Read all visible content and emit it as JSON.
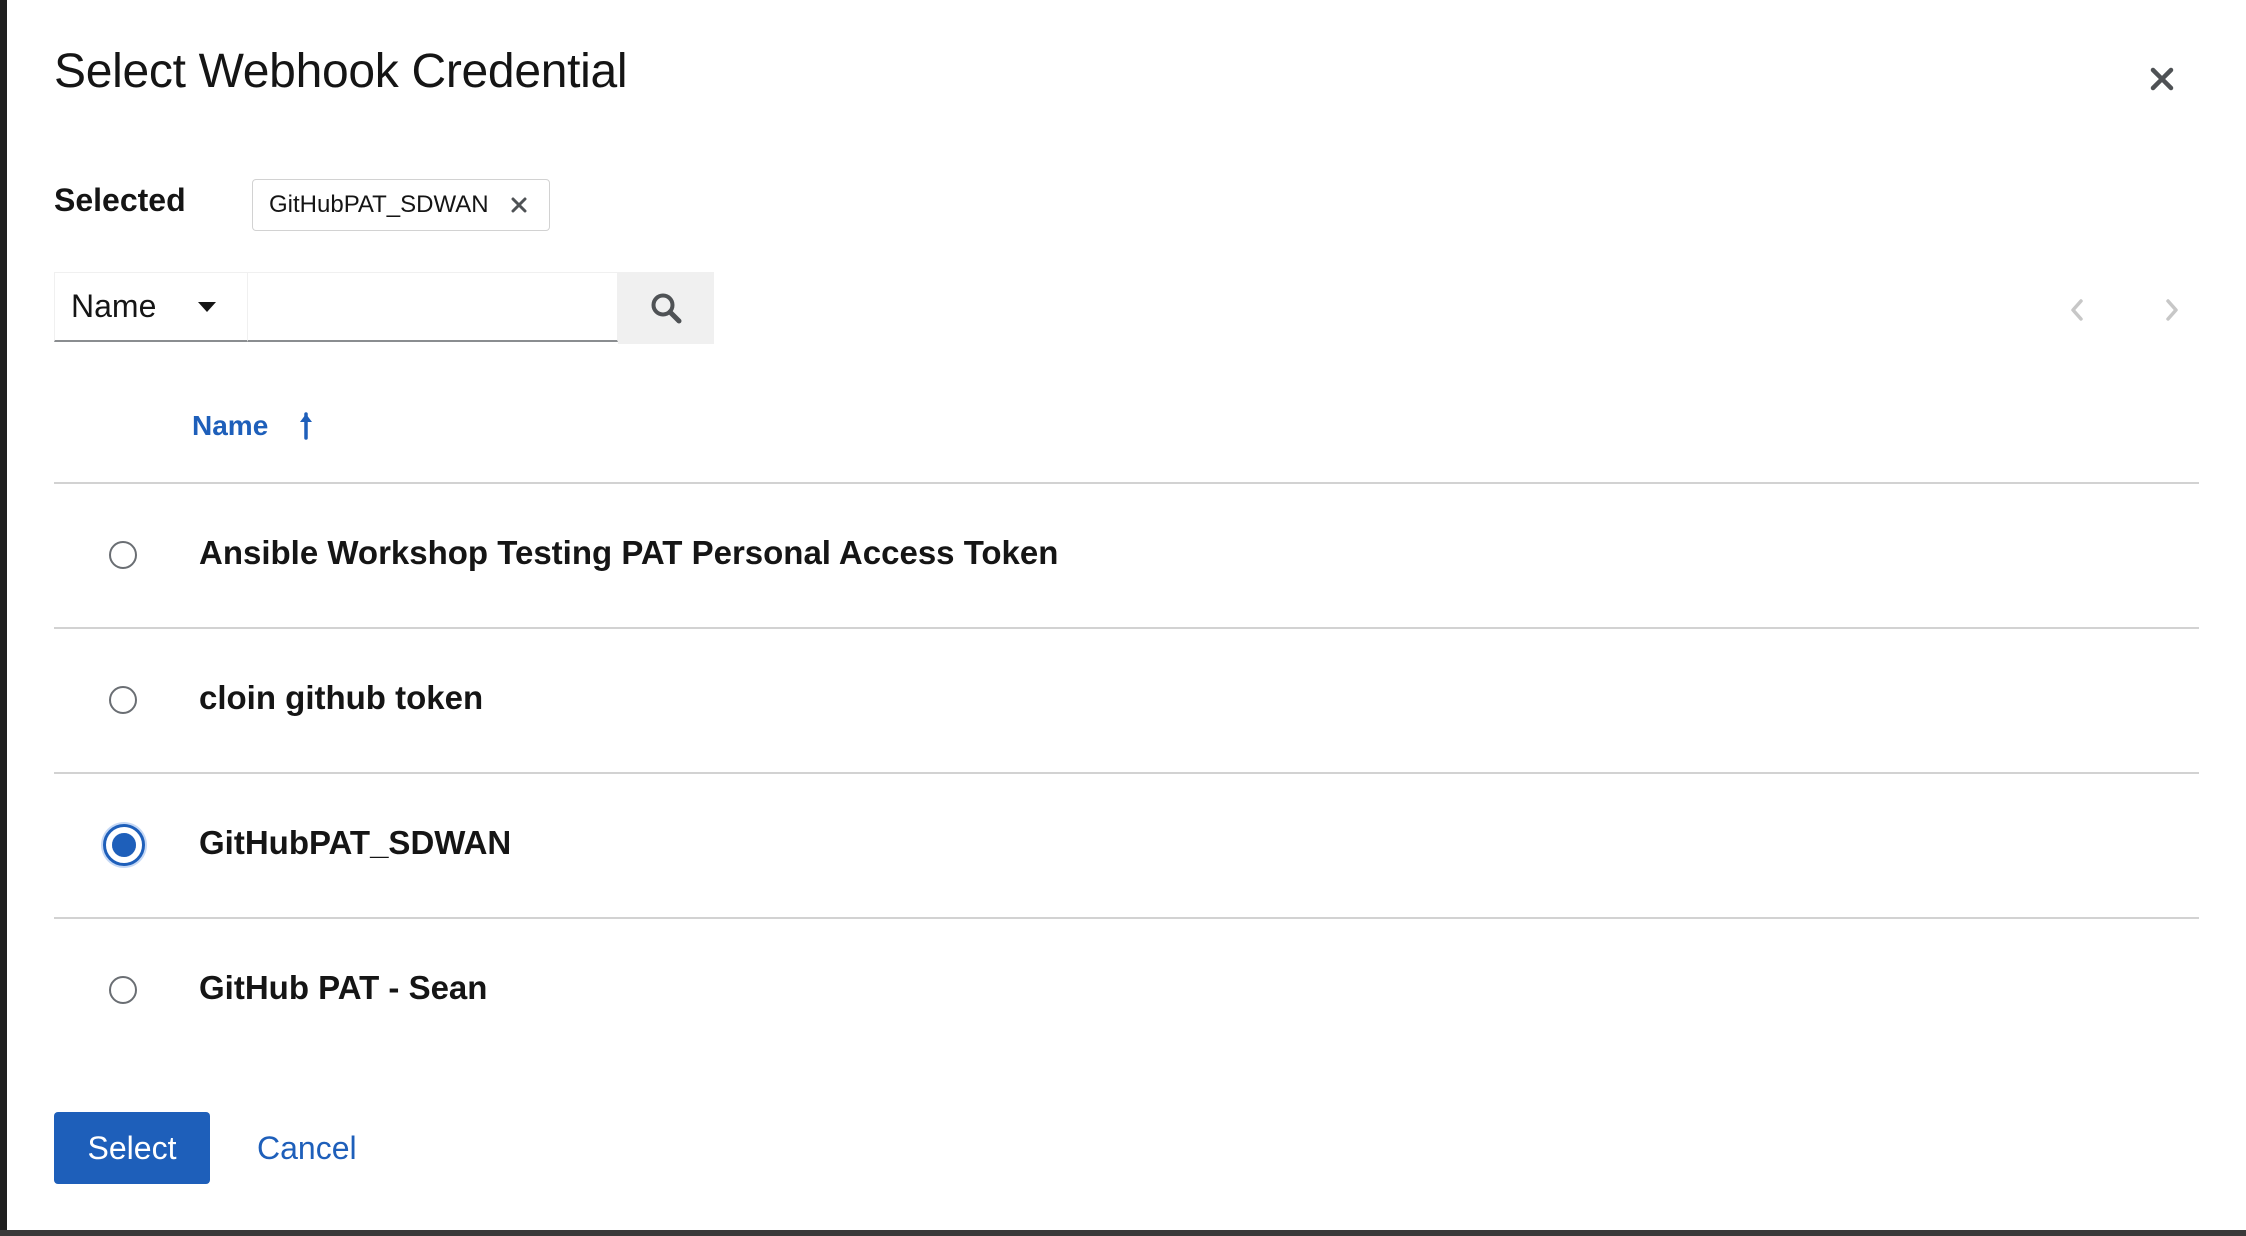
{
  "modal": {
    "title": "Select Webhook Credential",
    "close_icon": "close-icon"
  },
  "selected": {
    "label": "Selected",
    "chips": [
      {
        "text": "GitHubPAT_SDWAN"
      }
    ]
  },
  "toolbar": {
    "filter_label": "Name",
    "search_value": "",
    "search_placeholder": ""
  },
  "table": {
    "column_header": "Name",
    "sort": "ascending",
    "rows": [
      {
        "name": "Ansible Workshop Testing PAT Personal Access Token",
        "selected": false
      },
      {
        "name": "cloin github token",
        "selected": false
      },
      {
        "name": "GitHubPAT_SDWAN",
        "selected": true
      },
      {
        "name": "GitHub PAT - Sean",
        "selected": false
      }
    ]
  },
  "footer": {
    "select_label": "Select",
    "cancel_label": "Cancel"
  },
  "colors": {
    "accent": "#1e5fba",
    "text": "#151515",
    "border": "#d2d2d2"
  }
}
